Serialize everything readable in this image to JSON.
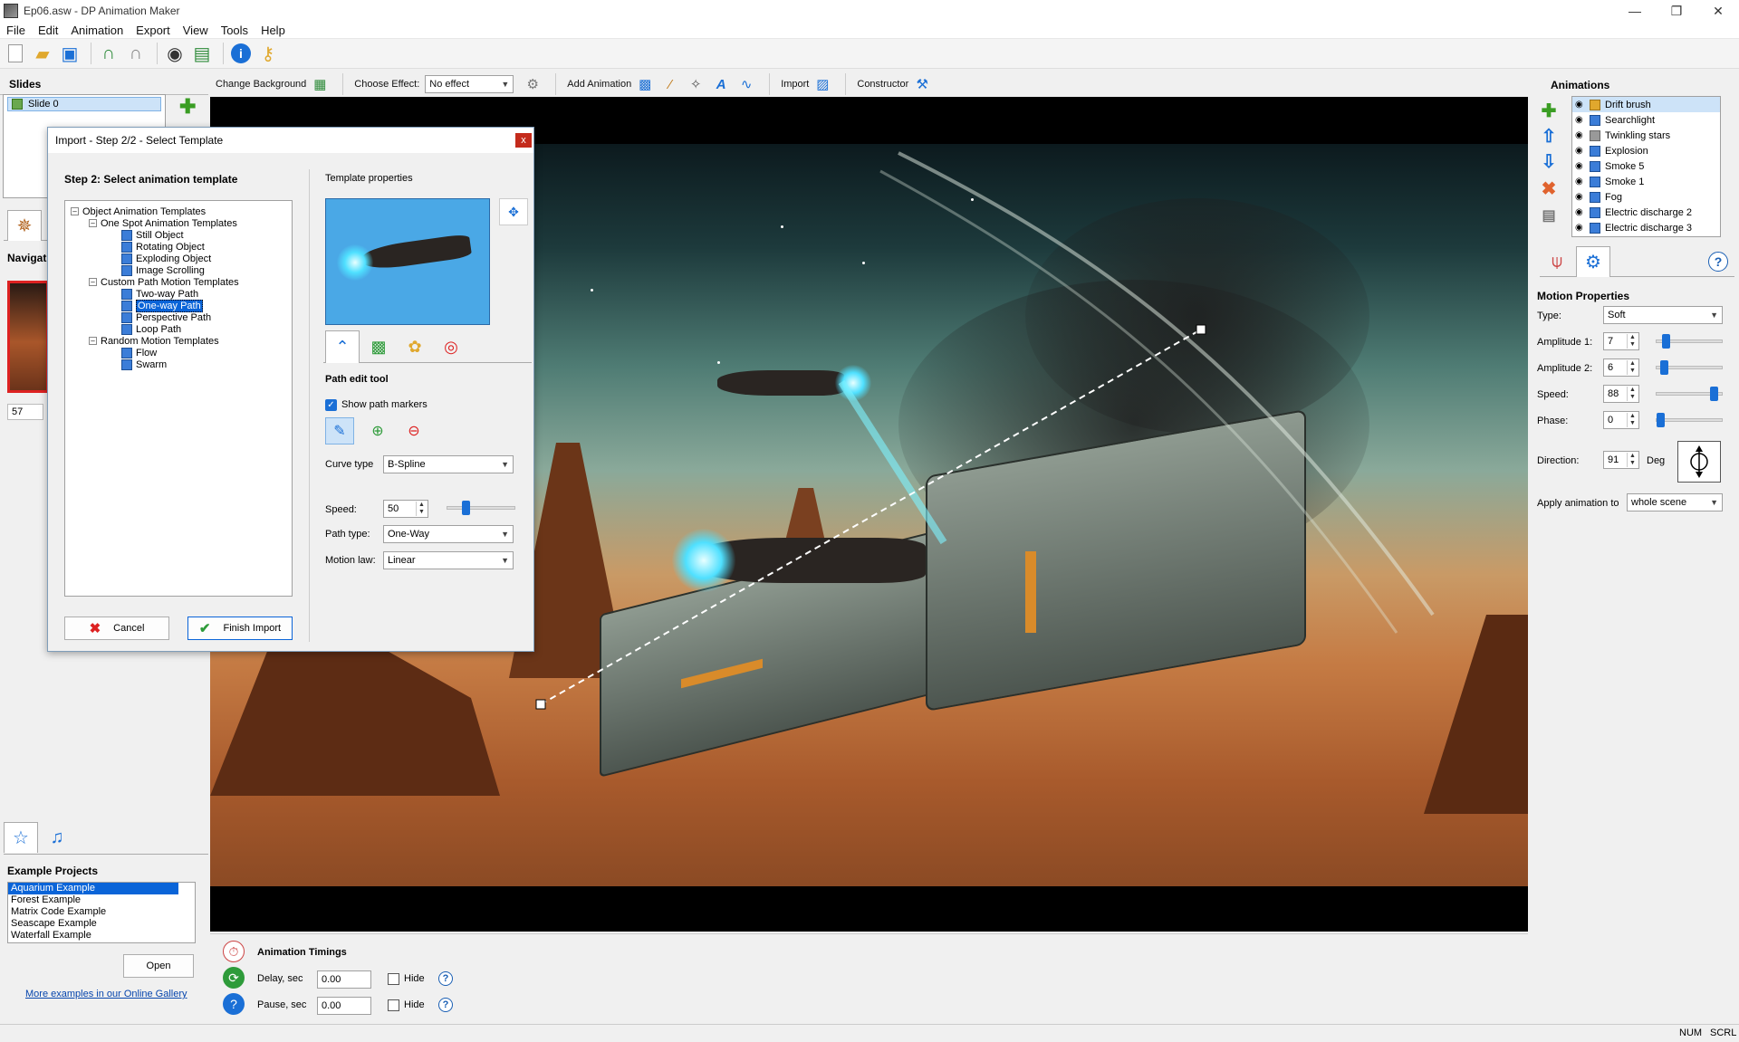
{
  "window": {
    "title": "Ep06.asw - DP Animation Maker",
    "controls": {
      "minimize": "—",
      "maximize": "❐",
      "close": "✕"
    }
  },
  "menu": [
    "File",
    "Edit",
    "Animation",
    "Export",
    "View",
    "Tools",
    "Help"
  ],
  "toolbar": {
    "icons": [
      "new-icon",
      "open-icon",
      "save-icon",
      "undo-icon",
      "redo-icon",
      "preview-icon",
      "publish-icon",
      "info-icon",
      "key-icon"
    ],
    "change_background": "Change Background",
    "choose_effect_label": "Choose Effect:",
    "choose_effect_value": "No effect",
    "add_animation": "Add Animation",
    "import": "Import",
    "constructor": "Constructor"
  },
  "slides": {
    "header": "Slides",
    "items": [
      "Slide 0"
    ]
  },
  "navigator": {
    "label": "Navigat",
    "thumb_number": "57"
  },
  "examples": {
    "header": "Example Projects",
    "items": [
      "Aquarium Example",
      "Forest Example",
      "Matrix Code Example",
      "Seascape Example",
      "Waterfall Example"
    ],
    "selected": "Aquarium Example",
    "open_button": "Open",
    "gallery_link": "More examples in our Online Gallery"
  },
  "timings": {
    "header": "Animation Timings",
    "delay_label": "Delay, sec",
    "delay_value": "0.00",
    "pause_label": "Pause, sec",
    "pause_value": "0.00",
    "hide_label": "Hide",
    "help": "?"
  },
  "animations": {
    "header": "Animations",
    "items": [
      "Drift brush",
      "Searchlight",
      "Twinkling stars",
      "Explosion",
      "Smoke 5",
      "Smoke 1",
      "Fog",
      "Electric discharge 2",
      "Electric discharge 3"
    ],
    "selected": "Drift brush"
  },
  "motion": {
    "header": "Motion Properties",
    "type_label": "Type:",
    "type_value": "Soft",
    "amplitude1_label": "Amplitude 1:",
    "amplitude1_value": "7",
    "amplitude2_label": "Amplitude 2:",
    "amplitude2_value": "6",
    "speed_label": "Speed:",
    "speed_value": "88",
    "phase_label": "Phase:",
    "phase_value": "0",
    "direction_label": "Direction:",
    "direction_value": "91",
    "direction_unit": "Deg",
    "apply_label": "Apply animation to",
    "apply_value": "whole scene",
    "help": "?"
  },
  "dialog": {
    "title": "Import - Step 2/2 - Select Template",
    "close": "x",
    "step_header": "Step 2: Select animation template",
    "tree": {
      "root": "Object Animation Templates",
      "groups": [
        {
          "label": "One Spot Animation Templates",
          "items": [
            "Still Object",
            "Rotating Object",
            "Exploding Object",
            "Image Scrolling"
          ]
        },
        {
          "label": "Custom Path Motion Templates",
          "items": [
            "Two-way Path",
            "One-way Path",
            "Perspective Path",
            "Loop Path"
          ]
        },
        {
          "label": "Random Motion Templates",
          "items": [
            "Flow",
            "Swarm"
          ]
        }
      ],
      "selected": "One-way Path",
      "expander": "–"
    },
    "template_properties": "Template properties",
    "path_edit_tool": "Path edit tool",
    "show_path_markers": "Show path markers",
    "curve_type_label": "Curve type",
    "curve_type_value": "B-Spline",
    "speed_label": "Speed:",
    "speed_value": "50",
    "path_type_label": "Path type:",
    "path_type_value": "One-Way",
    "motion_law_label": "Motion law:",
    "motion_law_value": "Linear",
    "cancel": "Cancel",
    "finish": "Finish Import"
  },
  "status": {
    "num": "NUM",
    "scrl": "SCRL"
  },
  "colors": {
    "accent": "#0a64d8",
    "selection": "#cde3f8"
  }
}
